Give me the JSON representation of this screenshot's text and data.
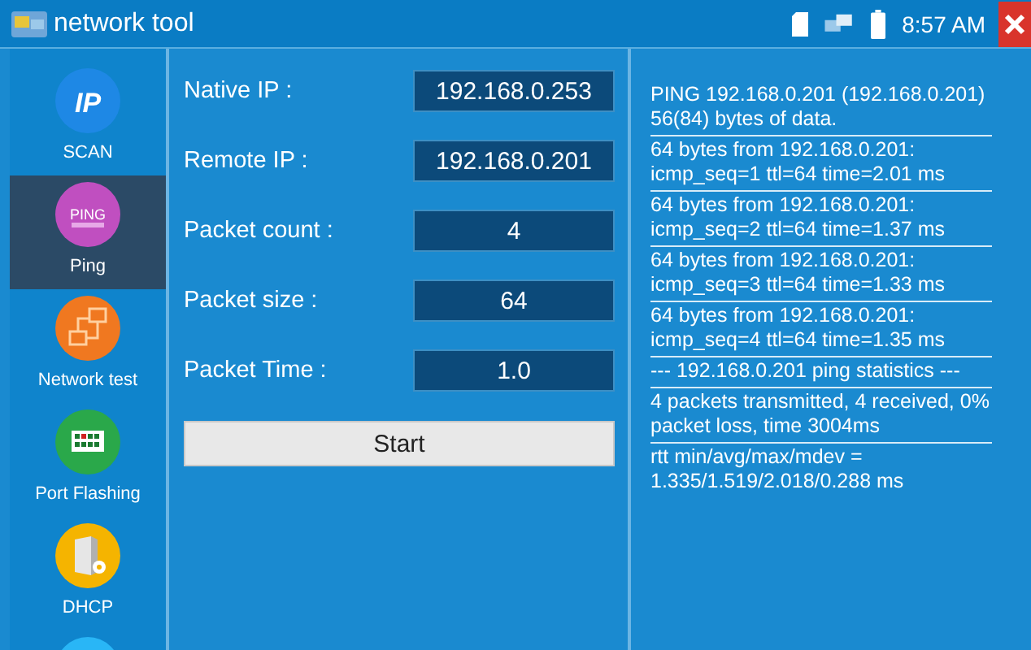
{
  "window": {
    "title": "network tool",
    "time": "8:57 AM"
  },
  "sidebar": {
    "items": [
      {
        "kind": "ip",
        "icon_text": "IP",
        "label": "SCAN",
        "selected": false
      },
      {
        "kind": "ping",
        "icon_text": "PING",
        "label": "Ping",
        "selected": true
      },
      {
        "kind": "network",
        "label": "Network test",
        "selected": false
      },
      {
        "kind": "port",
        "label": "Port Flashing",
        "selected": false
      },
      {
        "kind": "dhcp",
        "label": "DHCP",
        "selected": false
      },
      {
        "kind": "more",
        "selected": false
      }
    ]
  },
  "form": {
    "fields": [
      {
        "label": "Native IP :",
        "value": "192.168.0.253"
      },
      {
        "label": "Remote IP :",
        "value": "192.168.0.201"
      },
      {
        "label": "Packet count :",
        "value": "4"
      },
      {
        "label": "Packet size :",
        "value": "64"
      },
      {
        "label": "Packet Time :",
        "value": "1.0"
      }
    ],
    "button": "Start"
  },
  "log": [
    "PING 192.168.0.201 (192.168.0.201) 56(84) bytes of data.",
    "64 bytes from 192.168.0.201: icmp_seq=1 ttl=64 time=2.01 ms",
    "64 bytes from 192.168.0.201: icmp_seq=2 ttl=64 time=1.37 ms",
    "64 bytes from 192.168.0.201: icmp_seq=3 ttl=64 time=1.33 ms",
    "64 bytes from 192.168.0.201: icmp_seq=4 ttl=64 time=1.35 ms",
    "--- 192.168.0.201 ping statistics ---",
    "4 packets transmitted, 4 received, 0% packet loss, time 3004ms",
    "rtt min/avg/max/mdev = 1.335/1.519/2.018/0.288 ms"
  ]
}
